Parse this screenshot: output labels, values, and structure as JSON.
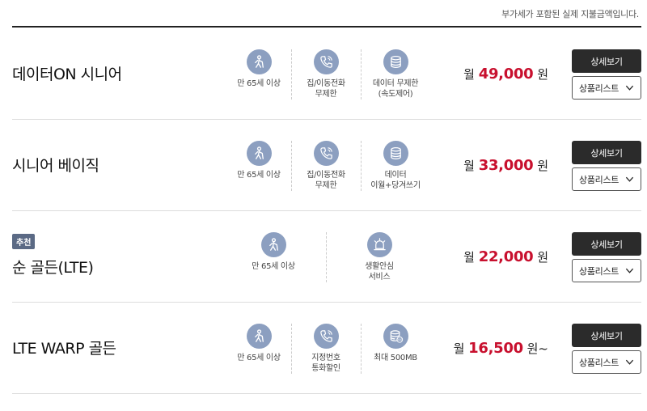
{
  "notice": "부가세가 포함된 실제 지불금액입니다.",
  "colors": {
    "accent_price": "#c8102e",
    "icon_bg": "#8c9fc0",
    "badge_bg": "#5b6a85",
    "button_dark": "#2b2b2b"
  },
  "plans": [
    {
      "name": "데이터ON 시니어",
      "features": [
        {
          "icon": "senior-person-icon",
          "label": "만 65세 이상"
        },
        {
          "icon": "phone-call-icon",
          "label": "집/이동전화\n무제한"
        },
        {
          "icon": "data-database-icon",
          "label": "데이터 무제한\n(속도제어)"
        }
      ],
      "price_prefix": "월",
      "price_amount": "49,000",
      "price_suffix": "원",
      "detail_label": "상세보기",
      "list_label": "상품리스트"
    },
    {
      "name": "시니어 베이직",
      "features": [
        {
          "icon": "senior-person-icon",
          "label": "만 65세 이상"
        },
        {
          "icon": "phone-call-icon",
          "label": "집/이동전화\n무제한"
        },
        {
          "icon": "data-database-icon",
          "label": "데이터\n이월+당겨쓰기"
        }
      ],
      "price_prefix": "월",
      "price_amount": "33,000",
      "price_suffix": "원",
      "detail_label": "상세보기",
      "list_label": "상품리스트"
    },
    {
      "badge": "추천",
      "name": "순 골든(LTE)",
      "features": [
        {
          "icon": "senior-person-icon",
          "label": "만 65세 이상"
        },
        {
          "icon": "alarm-siren-icon",
          "label": "생활안심\n서비스"
        }
      ],
      "price_prefix": "월",
      "price_amount": "22,000",
      "price_suffix": "원",
      "detail_label": "상세보기",
      "list_label": "상품리스트"
    },
    {
      "name": "LTE WARP 골든",
      "features": [
        {
          "icon": "senior-person-icon",
          "label": "만 65세 이상"
        },
        {
          "icon": "phone-call-icon",
          "label": "지정번호\n통화할인"
        },
        {
          "icon": "data-500-icon",
          "label": "최대 500MB"
        }
      ],
      "price_prefix": "월",
      "price_amount": "16,500",
      "price_suffix": "원~",
      "detail_label": "상세보기",
      "list_label": "상품리스트"
    }
  ]
}
